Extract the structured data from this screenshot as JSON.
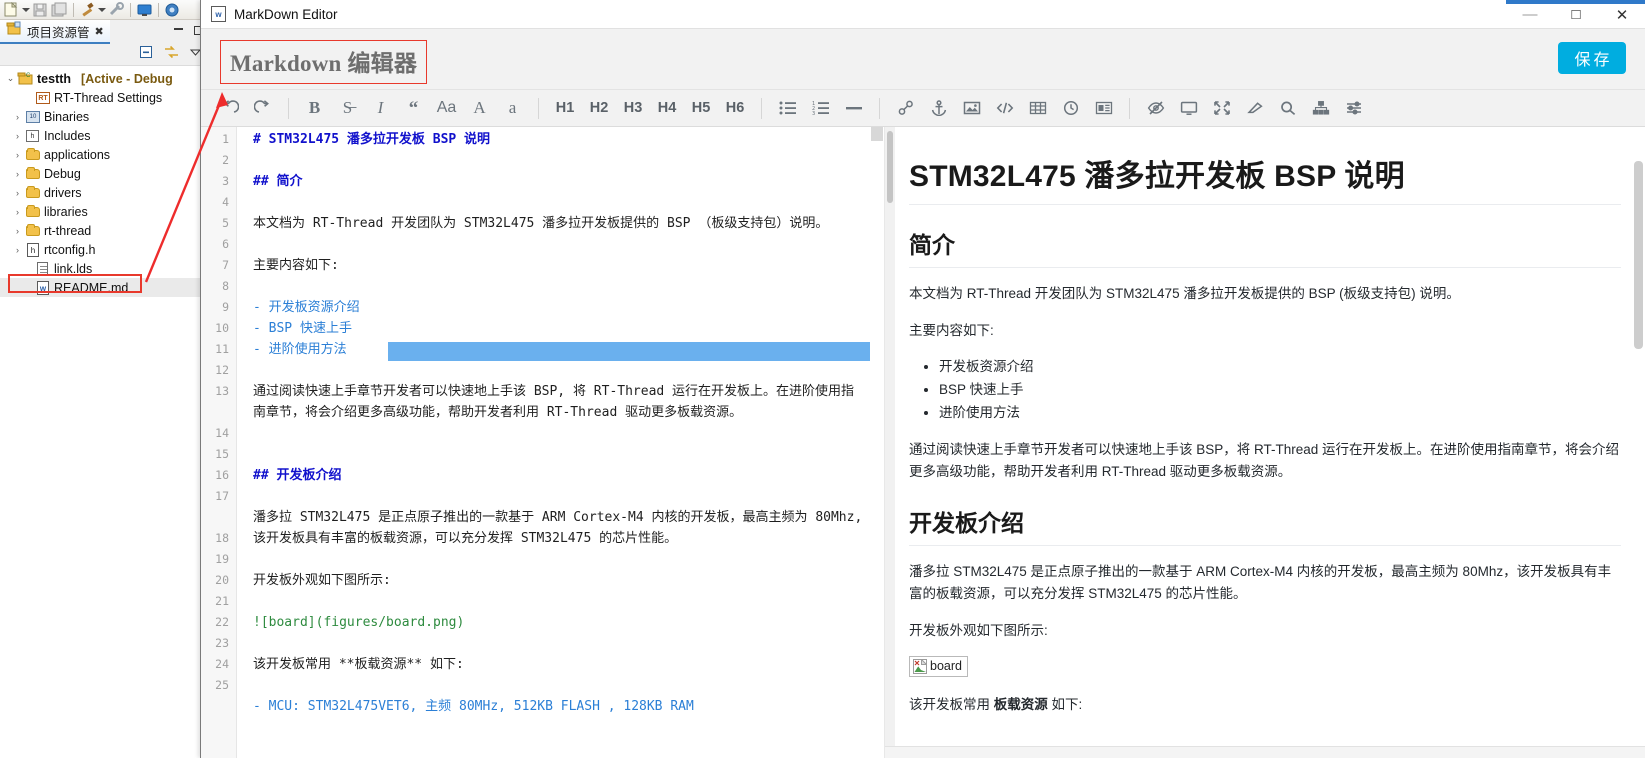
{
  "ide": {
    "toolbar_icons": [
      "new-file-icon",
      "dropdown-arrow-icon",
      "save-icon",
      "save-all-icon",
      "build-hammer-icon",
      "dropdown-arrow-icon",
      "debug-wrench-icon",
      "terminal-icon",
      "refresh-icon"
    ],
    "view_tab": {
      "label": "项目资源管",
      "close_glyph": "✖",
      "minimize_glyph": "—",
      "maximize_glyph": "□"
    },
    "view_toolbar_icons": [
      "collapse-all-icon",
      "link-with-editor-icon",
      "view-menu-icon"
    ],
    "tree": [
      {
        "label": "testth",
        "suffix": "[Active - Debug",
        "icon": "project-icon",
        "arrow": "⌄",
        "indent": 0,
        "bold": true
      },
      {
        "label": "RT-Thread Settings",
        "icon": "rt-thread-settings-icon",
        "arrow": "",
        "indent": 1
      },
      {
        "label": "Binaries",
        "icon": "binaries-icon",
        "arrow": "›",
        "indent": 1
      },
      {
        "label": "Includes",
        "icon": "includes-icon",
        "arrow": "›",
        "indent": 1
      },
      {
        "label": "applications",
        "icon": "folder-icon",
        "arrow": "›",
        "indent": 1
      },
      {
        "label": "Debug",
        "icon": "folder-icon",
        "arrow": "›",
        "indent": 1
      },
      {
        "label": "drivers",
        "icon": "folder-icon",
        "arrow": "›",
        "indent": 1
      },
      {
        "label": "libraries",
        "icon": "folder-icon",
        "arrow": "›",
        "indent": 1
      },
      {
        "label": "rt-thread",
        "icon": "folder-icon",
        "arrow": "›",
        "indent": 1
      },
      {
        "label": "rtconfig.h",
        "icon": "header-file-icon",
        "arrow": "›",
        "indent": 1
      },
      {
        "label": "link.lds",
        "icon": "file-icon",
        "arrow": "",
        "indent": 1
      },
      {
        "label": "README.md",
        "icon": "markdown-file-icon",
        "arrow": "",
        "indent": 1,
        "selected": true
      }
    ]
  },
  "window": {
    "title": "MarkDown Editor",
    "icon": "markdown-file-icon",
    "controls": {
      "minimize": "—",
      "maximize": "□",
      "close": "✕"
    }
  },
  "header": {
    "app_title": "Markdown 编辑器",
    "save_label": "保存",
    "accent_color": "#00ade0",
    "highlight_border_color": "#e8392c"
  },
  "toolbar": {
    "groups": [
      {
        "items": [
          {
            "name": "undo-icon",
            "glyph": "↶"
          },
          {
            "name": "redo-icon",
            "glyph": "↷"
          }
        ]
      },
      {
        "items": [
          {
            "name": "bold-icon",
            "glyph": "B",
            "style": "serif-bold"
          },
          {
            "name": "strikethrough-icon",
            "glyph": "S̶",
            "style": "serif"
          },
          {
            "name": "italic-icon",
            "glyph": "I",
            "style": "serif-italic"
          },
          {
            "name": "quote-icon",
            "glyph": "“",
            "style": "serif-bold"
          },
          {
            "name": "font-size-icon",
            "glyph": "Aa",
            "style": "plain"
          },
          {
            "name": "uppercase-icon",
            "glyph": "A",
            "style": "serif"
          },
          {
            "name": "lowercase-icon",
            "glyph": "a",
            "style": "serif"
          }
        ]
      },
      {
        "items": [
          {
            "name": "heading-1-button",
            "glyph": "H1",
            "style": "hx"
          },
          {
            "name": "heading-2-button",
            "glyph": "H2",
            "style": "hx"
          },
          {
            "name": "heading-3-button",
            "glyph": "H3",
            "style": "hx"
          },
          {
            "name": "heading-4-button",
            "glyph": "H4",
            "style": "hx"
          },
          {
            "name": "heading-5-button",
            "glyph": "H5",
            "style": "hx"
          },
          {
            "name": "heading-6-button",
            "glyph": "H6",
            "style": "hx"
          }
        ]
      },
      {
        "items": [
          {
            "name": "unordered-list-icon",
            "glyph": "svg:ul"
          },
          {
            "name": "ordered-list-icon",
            "glyph": "svg:ol"
          },
          {
            "name": "horizontal-rule-icon",
            "glyph": "svg:hr"
          }
        ]
      },
      {
        "items": [
          {
            "name": "link-icon",
            "glyph": "svg:link"
          },
          {
            "name": "anchor-icon",
            "glyph": "svg:anchor"
          },
          {
            "name": "image-icon",
            "glyph": "svg:image"
          },
          {
            "name": "code-icon",
            "glyph": "svg:code"
          },
          {
            "name": "table-icon",
            "glyph": "svg:table"
          },
          {
            "name": "datetime-icon",
            "glyph": "svg:clock"
          },
          {
            "name": "reference-icon",
            "glyph": "svg:article"
          }
        ]
      },
      {
        "items": [
          {
            "name": "toggle-preview-icon",
            "glyph": "svg:eye-slash"
          },
          {
            "name": "watch-monitor-icon",
            "glyph": "svg:monitor"
          },
          {
            "name": "fullscreen-icon",
            "glyph": "svg:expand"
          },
          {
            "name": "eraser-icon",
            "glyph": "svg:eraser"
          },
          {
            "name": "search-icon",
            "glyph": "svg:search"
          },
          {
            "name": "toc-sitemap-icon",
            "glyph": "svg:sitemap"
          },
          {
            "name": "settings-sliders-icon",
            "glyph": "svg:sliders"
          }
        ]
      }
    ]
  },
  "editor": {
    "selection": {
      "line": 11,
      "color": "#6ab0ee"
    },
    "lines": [
      {
        "n": 1,
        "text": "# STM32L475 潘多拉开发板 BSP 说明",
        "kind": "heading"
      },
      {
        "n": 2,
        "text": "",
        "kind": "blank"
      },
      {
        "n": 3,
        "text": "## 简介",
        "kind": "heading"
      },
      {
        "n": 4,
        "text": "",
        "kind": "blank"
      },
      {
        "n": 5,
        "text": "本文档为 RT-Thread 开发团队为 STM32L475 潘多拉开发板提供的 BSP （板级支持包）说明。",
        "kind": "text"
      },
      {
        "n": 6,
        "text": "",
        "kind": "blank"
      },
      {
        "n": 7,
        "text": "主要内容如下:",
        "kind": "text"
      },
      {
        "n": 8,
        "text": "",
        "kind": "blank"
      },
      {
        "n": 9,
        "text": "- 开发板资源介绍",
        "kind": "list"
      },
      {
        "n": 10,
        "text": "- BSP 快速上手",
        "kind": "list"
      },
      {
        "n": 11,
        "text": "- 进阶使用方法",
        "kind": "list"
      },
      {
        "n": 12,
        "text": "",
        "kind": "blank"
      },
      {
        "n": 13,
        "text": "通过阅读快速上手章节开发者可以快速地上手该 BSP, 将 RT-Thread 运行在开发板上。在进阶使用指",
        "text2": "南章节，将会介绍更多高级功能，帮助开发者利用 RT-Thread 驱动更多板载资源。",
        "kind": "text-wrapped"
      },
      {
        "n": 14,
        "text": "",
        "kind": "blank"
      },
      {
        "n": 15,
        "text": "## 开发板介绍",
        "kind": "heading"
      },
      {
        "n": 16,
        "text": "",
        "kind": "blank"
      },
      {
        "n": 17,
        "text": "潘多拉 STM32L475 是正点原子推出的一款基于 ARM Cortex-M4 内核的开发板，最高主频为 80Mhz,",
        "text2": "该开发板具有丰富的板载资源，可以充分发挥 STM32L475 的芯片性能。",
        "kind": "text-wrapped"
      },
      {
        "n": 18,
        "text": "",
        "kind": "blank"
      },
      {
        "n": 19,
        "text": "开发板外观如下图所示:",
        "kind": "text"
      },
      {
        "n": 20,
        "text": "",
        "kind": "blank"
      },
      {
        "n": 21,
        "text": "![board](figures/board.png)",
        "kind": "image"
      },
      {
        "n": 22,
        "text": "",
        "kind": "blank"
      },
      {
        "n": 23,
        "text": "该开发板常用 **板载资源** 如下:",
        "kind": "text-bold"
      },
      {
        "n": 24,
        "text": "",
        "kind": "blank"
      },
      {
        "n": 25,
        "text": "- MCU: STM32L475VET6, 主频 80MHz, 512KB FLASH , 128KB RAM",
        "kind": "list"
      }
    ]
  },
  "preview": {
    "h1": "STM32L475 潘多拉开发板 BSP 说明",
    "h2_intro": "简介",
    "p_intro": "本文档为 RT-Thread 开发团队为 STM32L475 潘多拉开发板提供的 BSP (板级支持包) 说明。",
    "p_contents_label": "主要内容如下:",
    "bullets": [
      "开发板资源介绍",
      "BSP 快速上手",
      "进阶使用方法"
    ],
    "p_reading": "通过阅读快速上手章节开发者可以快速地上手该 BSP，将 RT-Thread 运行在开发板上。在进阶使用指南章节，将会介绍更多高级功能，帮助开发者利用 RT-Thread 驱动更多板载资源。",
    "h2_board": "开发板介绍",
    "p_board": "潘多拉 STM32L475 是正点原子推出的一款基于 ARM Cortex-M4 内核的开发板，最高主频为 80Mhz，该开发板具有丰富的板载资源，可以充分发挥 STM32L475 的芯片性能。",
    "p_appearance": "开发板外观如下图所示:",
    "image_alt": "board",
    "p_resource_pre": "该开发板常用 ",
    "p_resource_strong": "板载资源",
    "p_resource_post": " 如下:"
  }
}
